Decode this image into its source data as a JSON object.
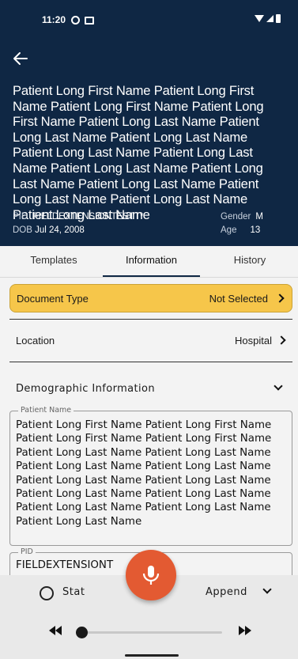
{
  "status_bar": {
    "time": "11:20"
  },
  "header": {
    "patient_name": "Patient Long First Name Patient Long First Name Patient Long First Name Patient Long First Name Patient Long Last Name Patient Long Last Name Patient Long Last Name Patient Long Last Name Patient Long Last Name Patient Long Last Name Patient Long Last Name Patient Long Last Name Patient Long Last Name Patient Long Last Name Patient Long Last Name",
    "pid_label": "PID",
    "pid_value": "FIELDEXTENSIONTESTT*",
    "gender_label": "Gender",
    "gender_value": "M",
    "dob_label": "DOB",
    "dob_value": "Jul 24, 2008",
    "age_label": "Age",
    "age_value": "13"
  },
  "tabs": [
    {
      "label": "Templates",
      "active": false
    },
    {
      "label": "Information",
      "active": true
    },
    {
      "label": "History",
      "active": false
    }
  ],
  "document_type": {
    "label": "Document Type",
    "value": "Not Selected"
  },
  "location": {
    "label": "Location",
    "value": "Hospital"
  },
  "demographic": {
    "label": "Demographic Information"
  },
  "fields": {
    "patient_name": {
      "legend": "Patient Name",
      "value": "Patient Long First Name Patient Long First Name Patient Long First Name Patient Long First Name Patient Long Last Name Patient Long Last Name Patient Long Last Name Patient Long Last Name Patient Long Last Name Patient Long Last Name Patient Long Last Name Patient Long Last Name Patient Long Last Name Patient Long Last Name Patient Long Last Name"
    },
    "pid": {
      "legend": "PID",
      "value": "FIELDEXTENSIONT"
    }
  },
  "bottom": {
    "stat_label": "Stat",
    "append_label": "Append",
    "playback_progress": 0.0
  },
  "colors": {
    "header_bg": "#0f2744",
    "accent_yellow": "#f6c64a",
    "mic_orange": "#e35a32"
  }
}
